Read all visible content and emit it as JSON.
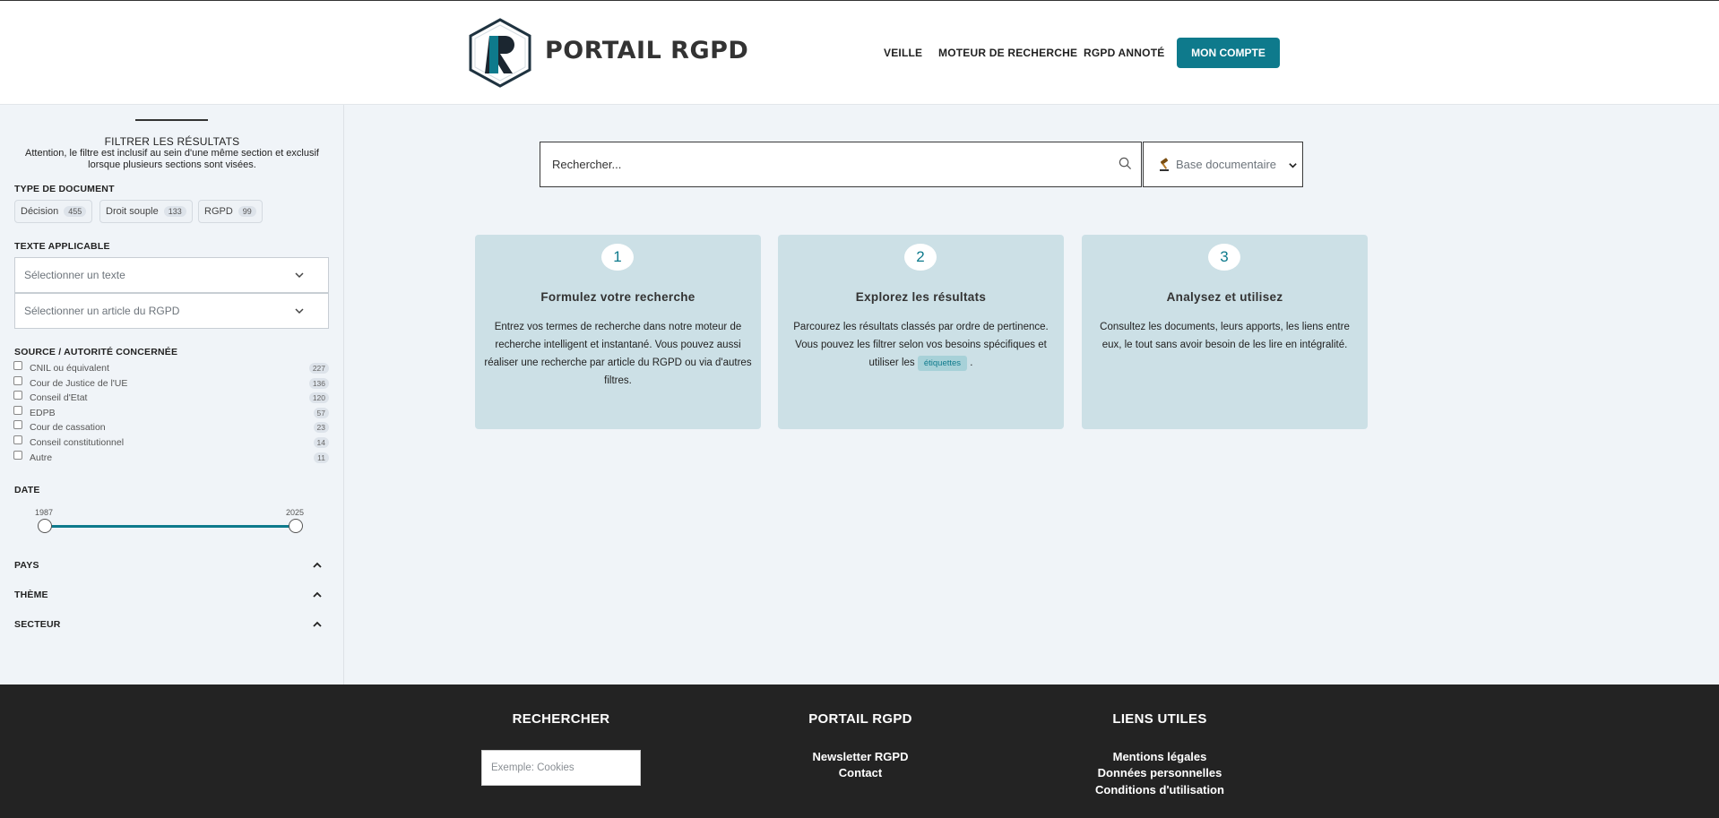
{
  "header": {
    "brand": "PORTAIL RGPD",
    "nav": [
      "VEILLE",
      "MOTEUR DE RECHERCHE",
      "RGPD ANNOTÉ"
    ],
    "account_button": "MON COMPTE"
  },
  "sidebar": {
    "title": "FILTRER LES RÉSULTATS",
    "note": "Attention, le filtre est inclusif au sein d'une même section et exclusif lorsque plusieurs sections sont visées.",
    "doc_type": {
      "label": "TYPE DE DOCUMENT",
      "chips": [
        {
          "label": "Décision",
          "count": "455"
        },
        {
          "label": "Droit souple",
          "count": "133"
        },
        {
          "label": "RGPD",
          "count": "99"
        }
      ]
    },
    "text": {
      "label": "TEXTE APPLICABLE",
      "select_text": "Sélectionner un texte",
      "select_article": "Sélectionner un article du RGPD"
    },
    "source": {
      "label": "SOURCE / AUTORITÉ CONCERNÉE",
      "items": [
        {
          "label": "CNIL ou équivalent",
          "count": "227"
        },
        {
          "label": "Cour de Justice de l'UE",
          "count": "136"
        },
        {
          "label": "Conseil d'Etat",
          "count": "120"
        },
        {
          "label": "EDPB",
          "count": "57"
        },
        {
          "label": "Cour de cassation",
          "count": "23"
        },
        {
          "label": "Conseil constitutionnel",
          "count": "14"
        },
        {
          "label": "Autre",
          "count": "11"
        }
      ]
    },
    "date": {
      "label": "DATE",
      "min": "1987",
      "max": "2025"
    },
    "collapsibles": [
      "PAYS",
      "THÈME",
      "SECTEUR"
    ]
  },
  "search": {
    "placeholder": "Rechercher...",
    "base_select": "Base documentaire"
  },
  "cards": [
    {
      "num": "1",
      "title": "Formulez votre recherche",
      "desc": "Entrez vos termes de recherche dans notre moteur de recherche intelligent et instantané. Vous pouvez aussi réaliser une recherche par article du RGPD ou via d'autres filtres."
    },
    {
      "num": "2",
      "title": "Explorez les résultats",
      "desc": "Parcourez les résultats classés par ordre de pertinence. Vous pouvez les filtrer selon vos besoins spécifiques et utiliser les",
      "tag": "étiquettes",
      "desc_end": "."
    },
    {
      "num": "3",
      "title": "Analysez et utilisez",
      "desc": "Consultez les documents, leurs apports, les liens entre eux, le tout sans avoir besoin de les lire en intégralité."
    }
  ],
  "footer": {
    "col1": {
      "title": "RECHERCHER",
      "placeholder": "Exemple: Cookies"
    },
    "col2": {
      "title": "PORTAIL RGPD",
      "links": [
        "Newsletter RGPD",
        "Contact"
      ]
    },
    "col3": {
      "title": "LIENS UTILES",
      "links": [
        "Mentions légales",
        "Données personnelles",
        "Conditions d'utilisation"
      ]
    }
  },
  "colors": {
    "accent": "#0e7a8c",
    "card": "#cce0e6",
    "footer": "#232323"
  }
}
